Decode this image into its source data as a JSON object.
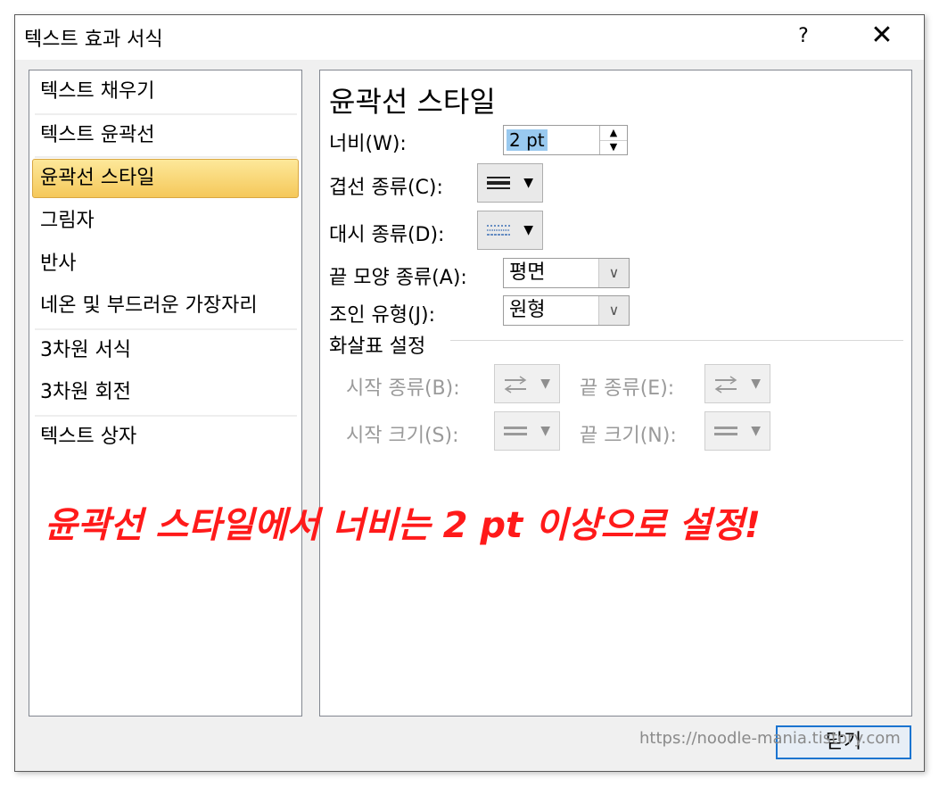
{
  "dialog": {
    "title": "텍스트 효과 서식",
    "help": "?",
    "close": "✕"
  },
  "nav": {
    "items": [
      {
        "label": "텍스트 채우기"
      },
      {
        "label": "텍스트 윤곽선"
      },
      {
        "label": "윤곽선 스타일",
        "selected": true
      },
      {
        "label": "그림자"
      },
      {
        "label": "반사"
      },
      {
        "label": "네온 및 부드러운 가장자리"
      },
      {
        "label": "3차원 서식"
      },
      {
        "label": "3차원 회전"
      },
      {
        "label": "텍스트 상자"
      }
    ]
  },
  "content": {
    "heading": "윤곽선 스타일",
    "width": {
      "label": "너비(W):",
      "value": "2 pt"
    },
    "compound_type": {
      "label": "겹선 종류(C):",
      "icon": "compound-line-icon"
    },
    "dash_type": {
      "label": "대시 종류(D):",
      "icon": "dash-line-icon"
    },
    "cap_type": {
      "label": "끝 모양 종류(A):",
      "value": "평면"
    },
    "join_type": {
      "label": "조인 유형(J):",
      "value": "원형"
    },
    "arrow_settings": {
      "title": "화살표 설정",
      "begin_type": "시작 종류(B):",
      "end_type": "끝 종류(E):",
      "begin_size": "시작 크기(S):",
      "end_size": "끝 크기(N):"
    }
  },
  "footer": {
    "close_button": "닫기",
    "watermark": "https://noodle-mania.tistory.com"
  },
  "annotation": "윤곽선 스타일에서 너비는 2 pt 이상으로 설정!",
  "colors": {
    "selection": "#f5c85a",
    "annotation": "#ff1a1a",
    "focus_border": "#1b74d0"
  }
}
